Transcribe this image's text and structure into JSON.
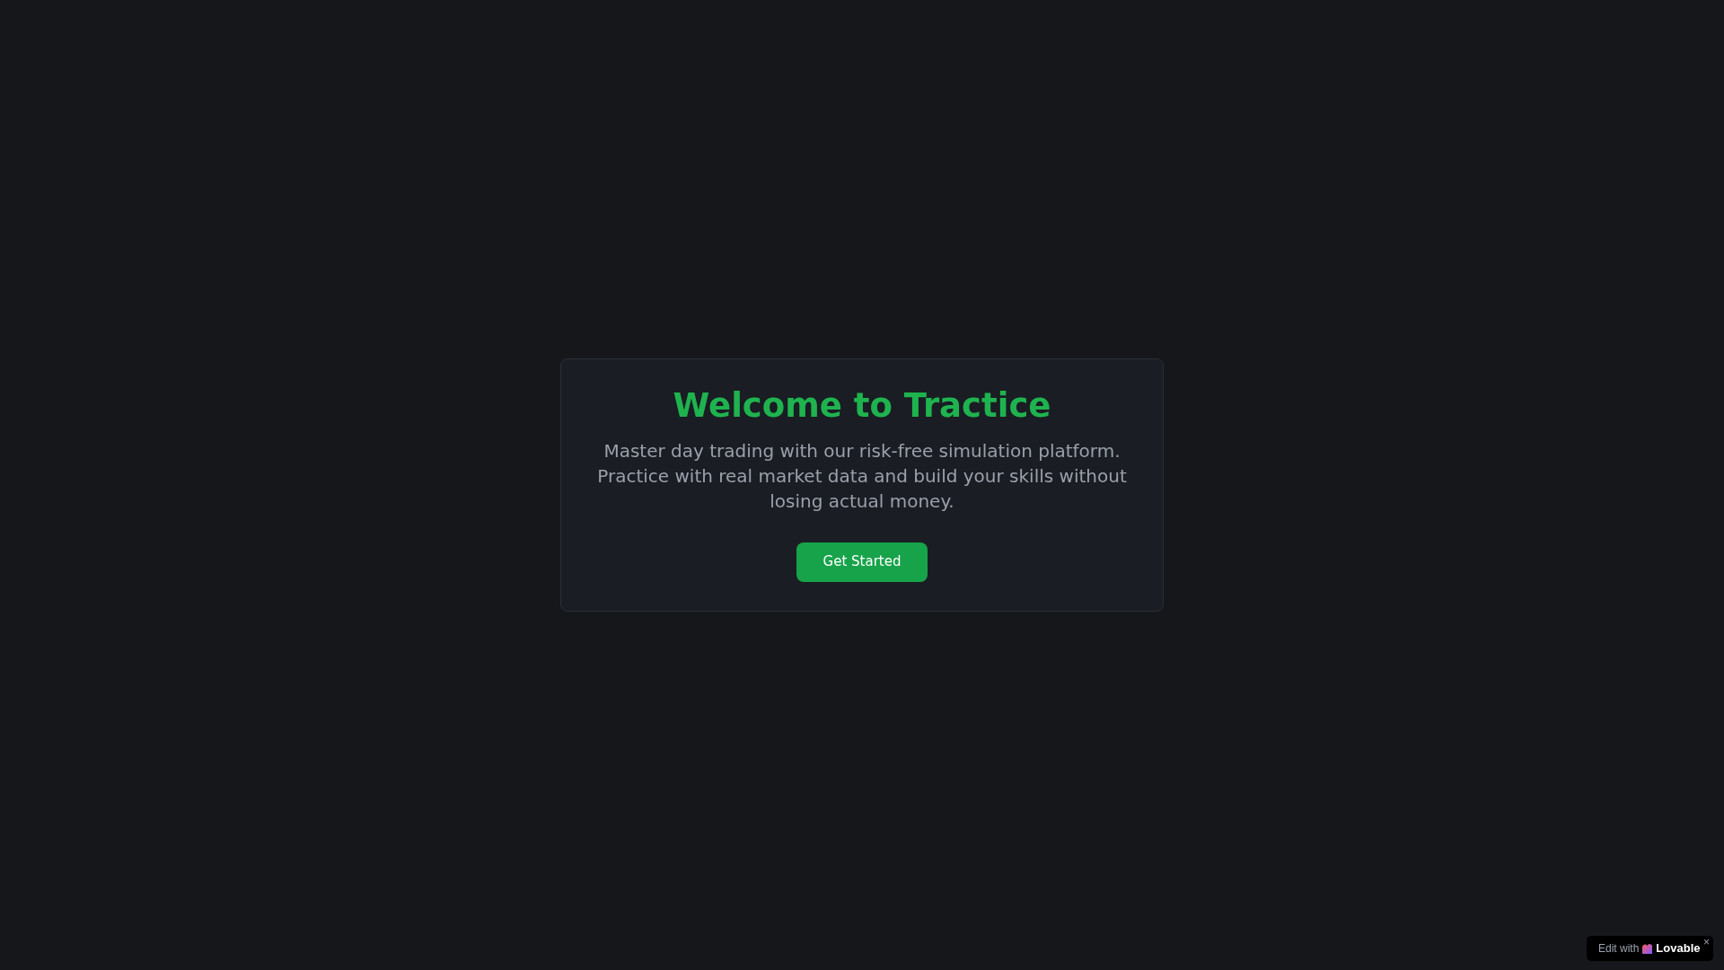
{
  "hero": {
    "title": "Welcome to Tractice",
    "description": "Master day trading with our risk-free simulation platform. Practice with real market data and build your skills without losing actual money.",
    "button": "Get Started"
  },
  "badge": {
    "label": "Edit with",
    "brand": "Lovable",
    "close": "×"
  }
}
